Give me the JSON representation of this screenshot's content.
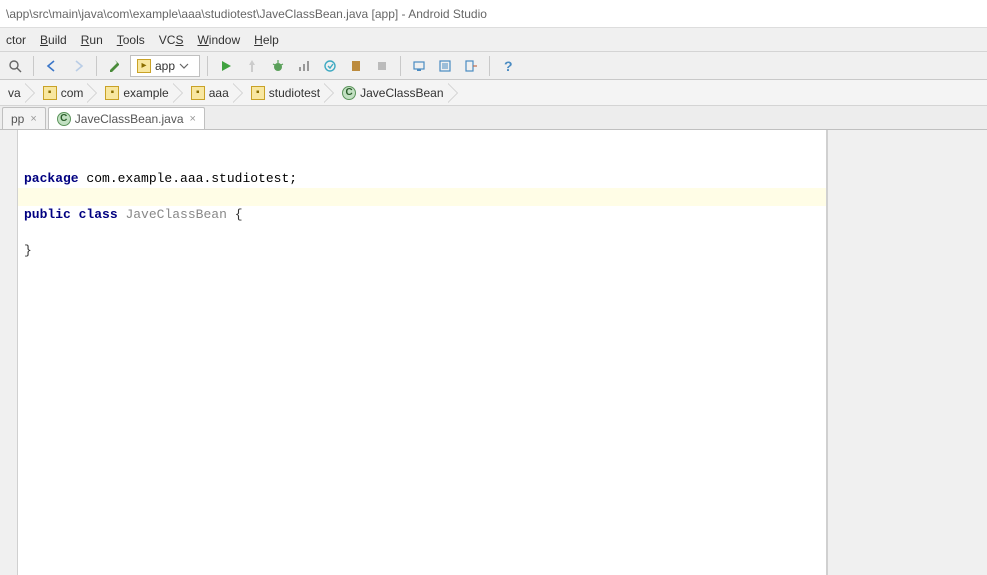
{
  "title": "\\app\\src\\main\\java\\com\\example\\aaa\\studiotest\\JaveClassBean.java [app] - Android Studio",
  "menu": {
    "items": [
      {
        "label": "ctor"
      },
      {
        "label": "Build",
        "mn": "B"
      },
      {
        "label": "Run",
        "mn": "R"
      },
      {
        "label": "Tools",
        "mn": "T"
      },
      {
        "label": "VCS",
        "mn": "S"
      },
      {
        "label": "Window",
        "mn": "W"
      },
      {
        "label": "Help",
        "mn": "H"
      }
    ]
  },
  "toolbar": {
    "module": "app"
  },
  "breadcrumb": {
    "items": [
      {
        "icon": "folder",
        "label": "va"
      },
      {
        "icon": "folder",
        "label": "com"
      },
      {
        "icon": "folder",
        "label": "example"
      },
      {
        "icon": "folder",
        "label": "aaa"
      },
      {
        "icon": "folder",
        "label": "studiotest"
      },
      {
        "icon": "class",
        "label": "JaveClassBean"
      }
    ]
  },
  "tabs": {
    "items": [
      {
        "label": "pp",
        "active": false
      },
      {
        "label": "JaveClassBean.java",
        "active": true,
        "icon": "class"
      }
    ]
  },
  "code": {
    "package_kw": "package",
    "package_name": "com.example.aaa.studiotest;",
    "public_kw": "public",
    "class_kw": "class",
    "class_name": "JaveClassBean",
    "brace_open": "{",
    "brace_close": "}",
    "highlight_line_index": 3
  }
}
